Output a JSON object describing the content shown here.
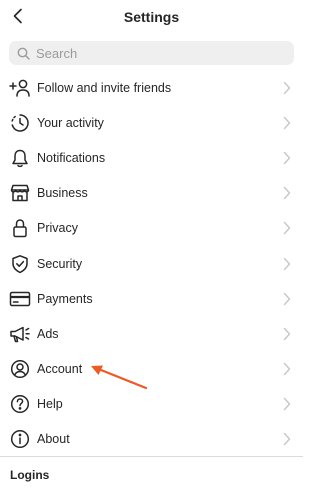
{
  "header": {
    "title": "Settings"
  },
  "search": {
    "placeholder": "Search"
  },
  "menu": {
    "items": [
      {
        "label": "Follow and invite friends",
        "icon": "add-person-icon"
      },
      {
        "label": "Your activity",
        "icon": "activity-clock-icon"
      },
      {
        "label": "Notifications",
        "icon": "bell-icon"
      },
      {
        "label": "Business",
        "icon": "storefront-icon"
      },
      {
        "label": "Privacy",
        "icon": "lock-icon"
      },
      {
        "label": "Security",
        "icon": "shield-check-icon"
      },
      {
        "label": "Payments",
        "icon": "credit-card-icon"
      },
      {
        "label": "Ads",
        "icon": "megaphone-icon"
      },
      {
        "label": "Account",
        "icon": "user-circle-icon"
      },
      {
        "label": "Help",
        "icon": "help-circle-icon"
      },
      {
        "label": "About",
        "icon": "info-circle-icon"
      }
    ]
  },
  "annotation": {
    "color": "#ee5a24",
    "target": "Account"
  },
  "sections": {
    "logins": "Logins"
  }
}
